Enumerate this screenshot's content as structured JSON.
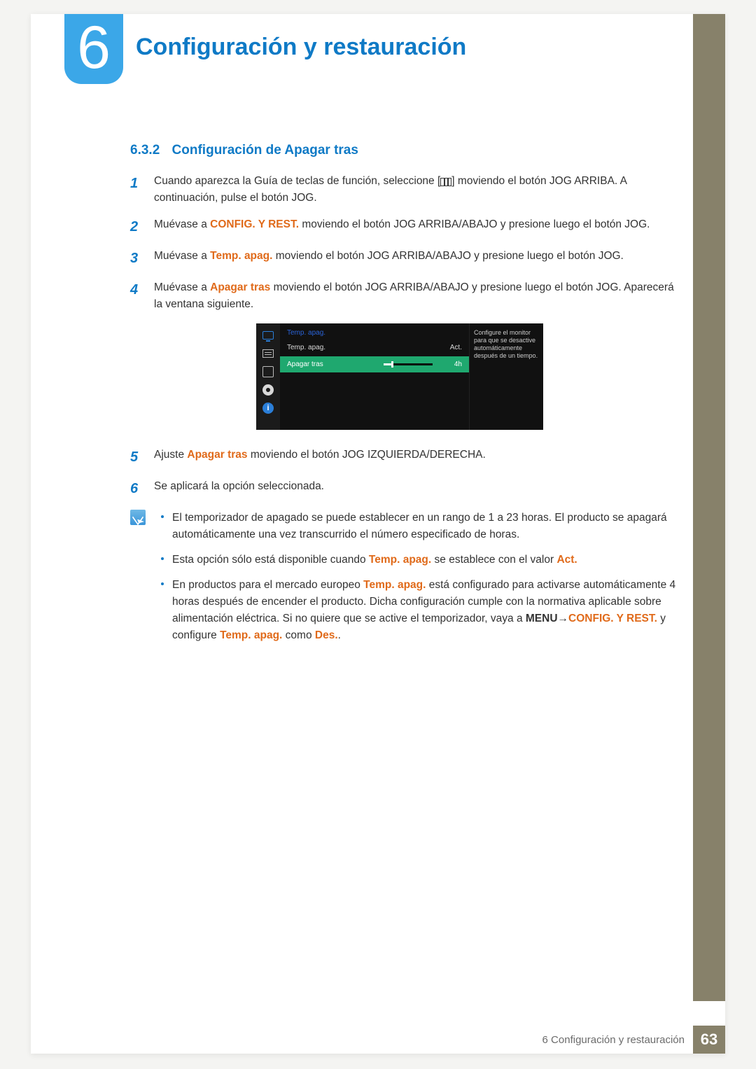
{
  "chapter": {
    "number": "6",
    "title": "Configuración y restauración"
  },
  "section": {
    "number": "6.3.2",
    "title": "Configuración de Apagar tras"
  },
  "steps": {
    "s1": {
      "n": "1",
      "pre": "Cuando aparezca la Guía de teclas de función, seleccione [",
      "post": "] moviendo el botón JOG ARRIBA. A continuación, pulse el botón JOG."
    },
    "s2": {
      "n": "2",
      "a": "Muévase a ",
      "hl": "CONFIG. Y REST.",
      "b": " moviendo el botón JOG ARRIBA/ABAJO y presione luego el botón JOG."
    },
    "s3": {
      "n": "3",
      "a": "Muévase a ",
      "hl": "Temp. apag.",
      "b": " moviendo el botón JOG ARRIBA/ABAJO y presione luego el botón JOG."
    },
    "s4": {
      "n": "4",
      "a": "Muévase a ",
      "hl": "Apagar tras",
      "b": " moviendo el botón JOG ARRIBA/ABAJO y presione luego el botón JOG. Aparecerá la ventana siguiente."
    },
    "s5": {
      "n": "5",
      "a": "Ajuste ",
      "hl": "Apagar tras",
      "b": " moviendo el botón JOG IZQUIERDA/DERECHA."
    },
    "s6": {
      "n": "6",
      "text": "Se aplicará la opción seleccionada."
    }
  },
  "osd": {
    "header": "Temp. apag.",
    "row1_label": "Temp. apag.",
    "row1_value": "Act.",
    "row2_label": "Apagar tras",
    "row2_value": "4h",
    "help": "Configure el monitor para que se desactive automáticamente después de un tiempo."
  },
  "notes": {
    "n1": "El temporizador de apagado se puede establecer en un rango de 1 a 23 horas. El producto se apagará automáticamente una vez transcurrido el número especificado de horas.",
    "n2": {
      "a": "Esta opción sólo está disponible cuando ",
      "hl1": "Temp. apag.",
      "b": " se establece con el valor ",
      "hl2": "Act.",
      "c": ""
    },
    "n3": {
      "a": "En productos para el mercado europeo ",
      "hl1": "Temp. apag.",
      "b": " está configurado para activarse automáticamente 4 horas después de encender el producto. Dicha configuración cumple con la normativa aplicable sobre alimentación eléctrica. Si no quiere que se active el temporizador, vaya a ",
      "menu": "MENU",
      "arrow": " → ",
      "hl2": "CONFIG. Y REST.",
      "c": " y configure ",
      "hl3": "Temp. apag.",
      "d": " como ",
      "hl4": "Des.",
      "e": "."
    }
  },
  "footer": {
    "title": "6 Configuración y restauración",
    "page": "63"
  }
}
